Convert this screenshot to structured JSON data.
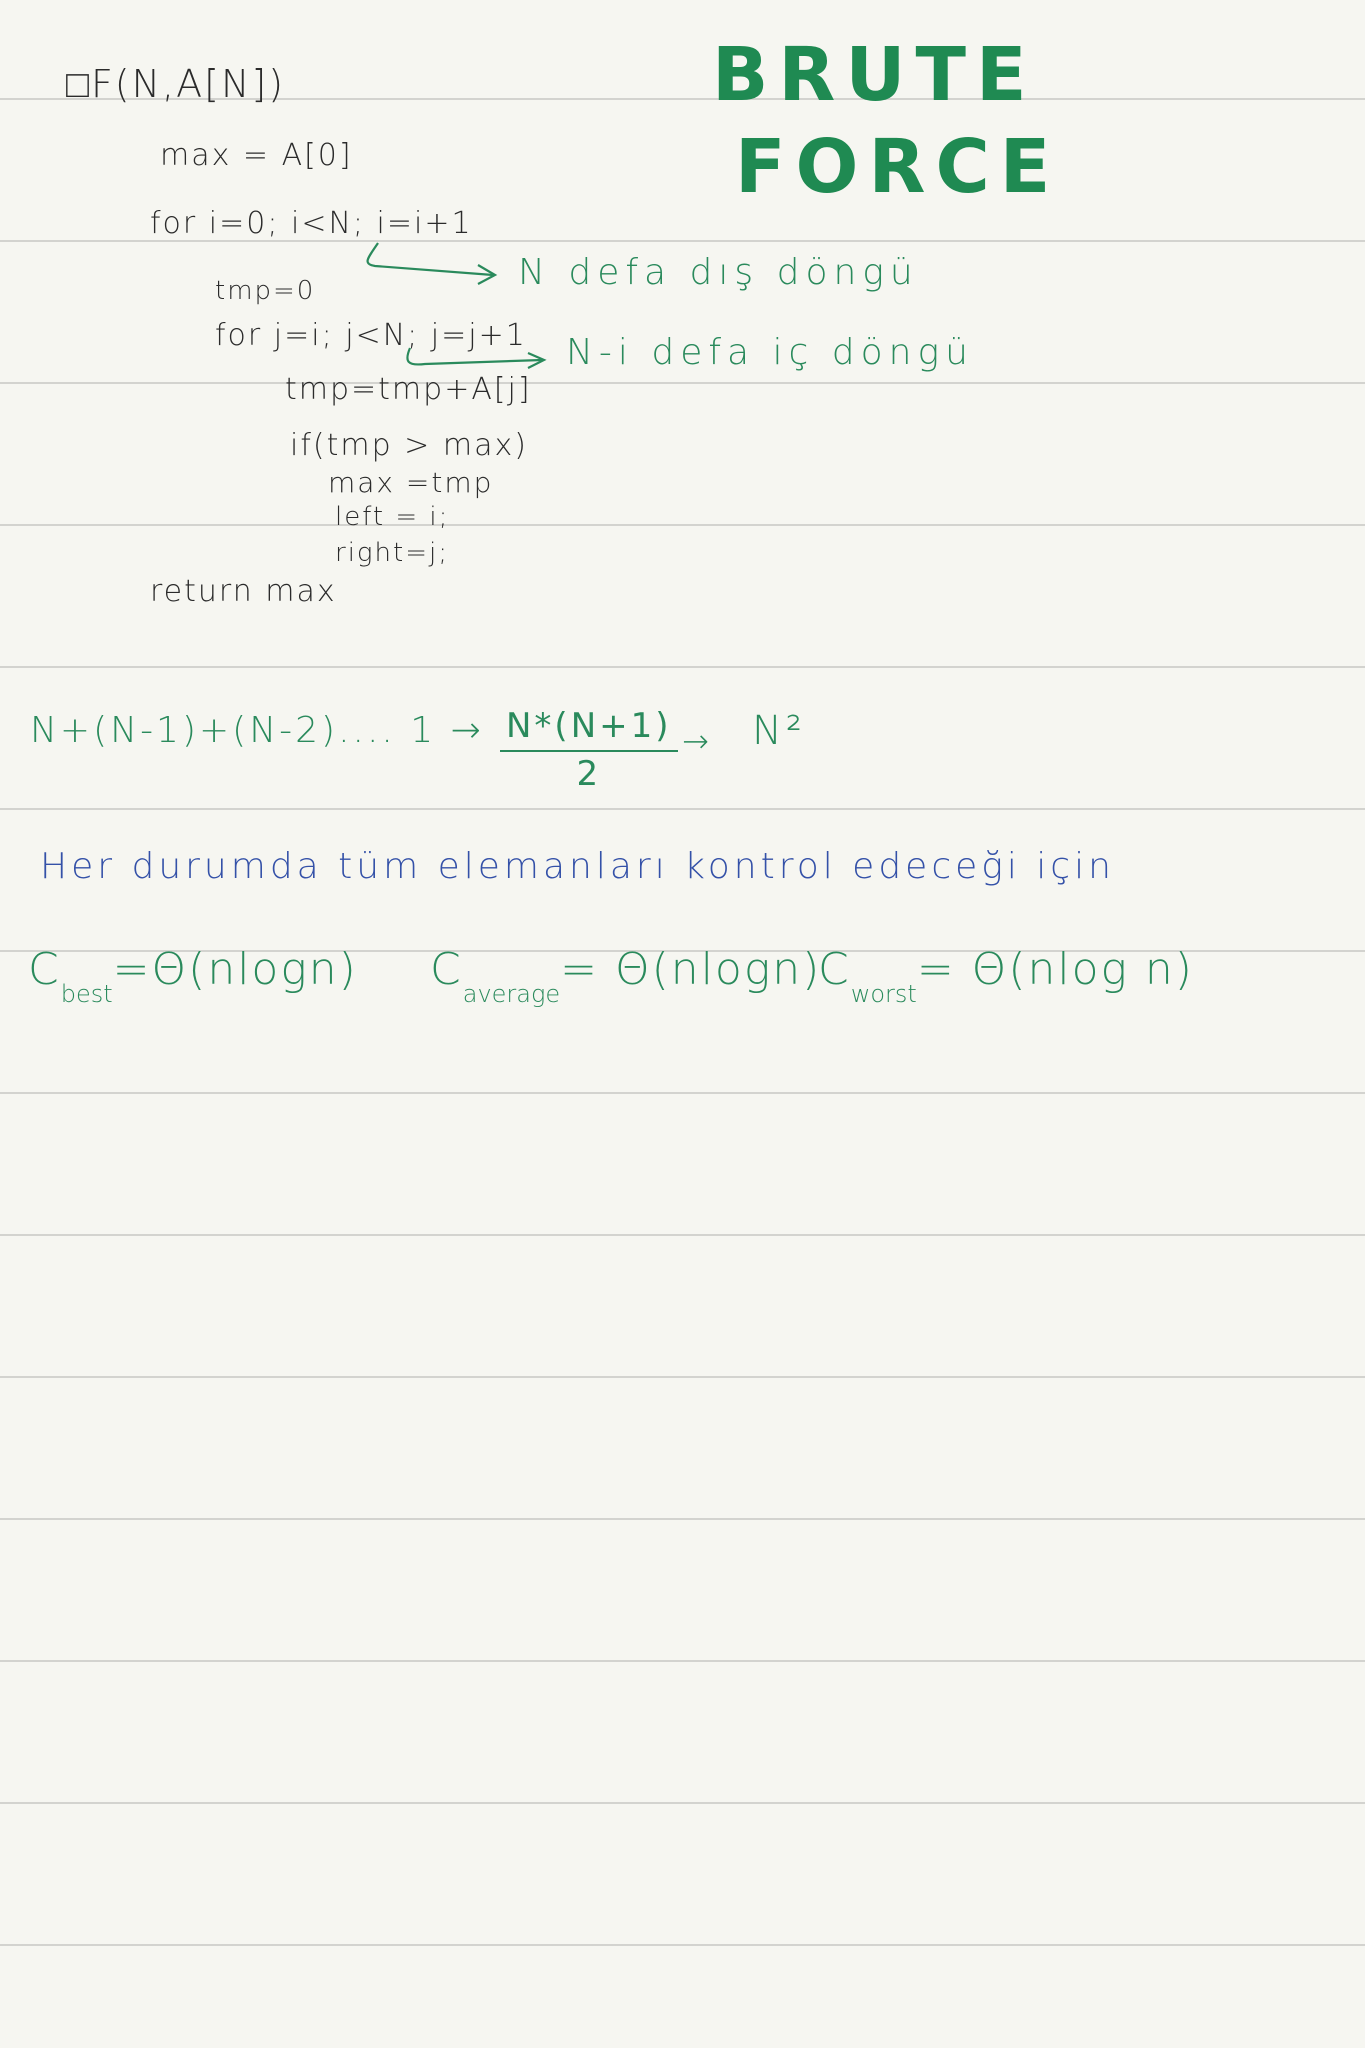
{
  "title": {
    "line1": "BRUTE",
    "line2": "FORCE"
  },
  "code": {
    "signature": "□F(N,A[N])",
    "line_max_init": "max = A[0]",
    "line_outer_for": "for   i=0; i<N; i=i+1",
    "line_tmp_init": "tmp=0",
    "line_inner_for": "for j=i; j<N; j=j+1",
    "line_accumulate": "tmp=tmp+A[j]",
    "line_if": "if(tmp > max)",
    "line_assign_max": "max =tmp",
    "line_left": "left = i;",
    "line_right": "right=j;",
    "line_return": "return   max"
  },
  "annotations": {
    "outer_loop": "N   defa   dış   döngü",
    "inner_loop": "N-i defa   iç   döngü"
  },
  "sum": {
    "series": "N+(N-1)+(N-2)....  1  →",
    "fraction_numerator": "N*(N+1)",
    "fraction_denominator": "2",
    "arrow": "→",
    "result": "N²"
  },
  "explanation": "Her   durumda   tüm   elemanları   kontrol   edeceği   için",
  "complexities": {
    "best": {
      "prefix": "C",
      "sub": "best",
      "value": "=Θ(nlogn)"
    },
    "average": {
      "prefix": "C",
      "sub": "average",
      "value": "= Θ(nlogn)"
    },
    "worst": {
      "prefix": "C",
      "sub": "worst",
      "value": "= Θ(nlog n)"
    }
  },
  "colors": {
    "title": "#1f8a52",
    "green_ink": "#2a8a5c",
    "blue_ink": "#3451a8",
    "code_ink": "#2b2b2b",
    "paper": "#f6f6f1",
    "rule_line": "#d3d3cf"
  }
}
